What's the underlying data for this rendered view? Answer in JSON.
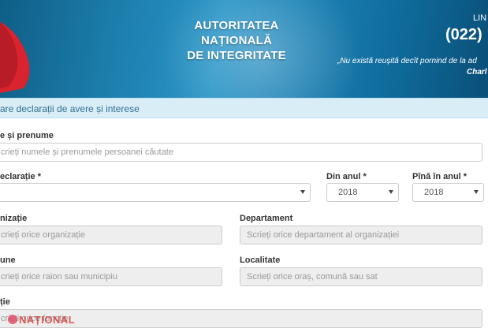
{
  "banner": {
    "title_lines": [
      "AUTORITATEA",
      "NAȚIONALĂ",
      "DE INTEGRITATE"
    ],
    "phone_label": "LIN",
    "phone": "(022)",
    "quote": "„Nu există reușită decît pornind de la ad",
    "author": "Charl"
  },
  "section": {
    "title": "are declarații de avere și interese"
  },
  "form": {
    "name": {
      "label": "e și prenume",
      "placeholder": "crieți numele și prenumele persoanei căutate"
    },
    "declaration": {
      "label": "eclarație *",
      "value": ""
    },
    "from_year": {
      "label": "Din anul *",
      "value": "2018"
    },
    "to_year": {
      "label": "Pînă în anul *",
      "value": "2018"
    },
    "organization": {
      "label": "nizație",
      "placeholder": "crieți orice organizație"
    },
    "department": {
      "label": "Departament",
      "placeholder": "Scrieți orice departament al organizației"
    },
    "district": {
      "label": "une",
      "placeholder": "crieți orice raion sau municipiu"
    },
    "locality": {
      "label": "Localitate",
      "placeholder": "Scrieți orice oraș, comună sau sat"
    },
    "function": {
      "label": "ție",
      "placeholder": "crieți orice funcție"
    }
  },
  "watermark": {
    "text": "NAȚIONAL"
  },
  "colors": {
    "banner": "#1d7fae",
    "section_bg": "#d9edf7",
    "section_text": "#31708f",
    "flag": "#d9232e"
  }
}
